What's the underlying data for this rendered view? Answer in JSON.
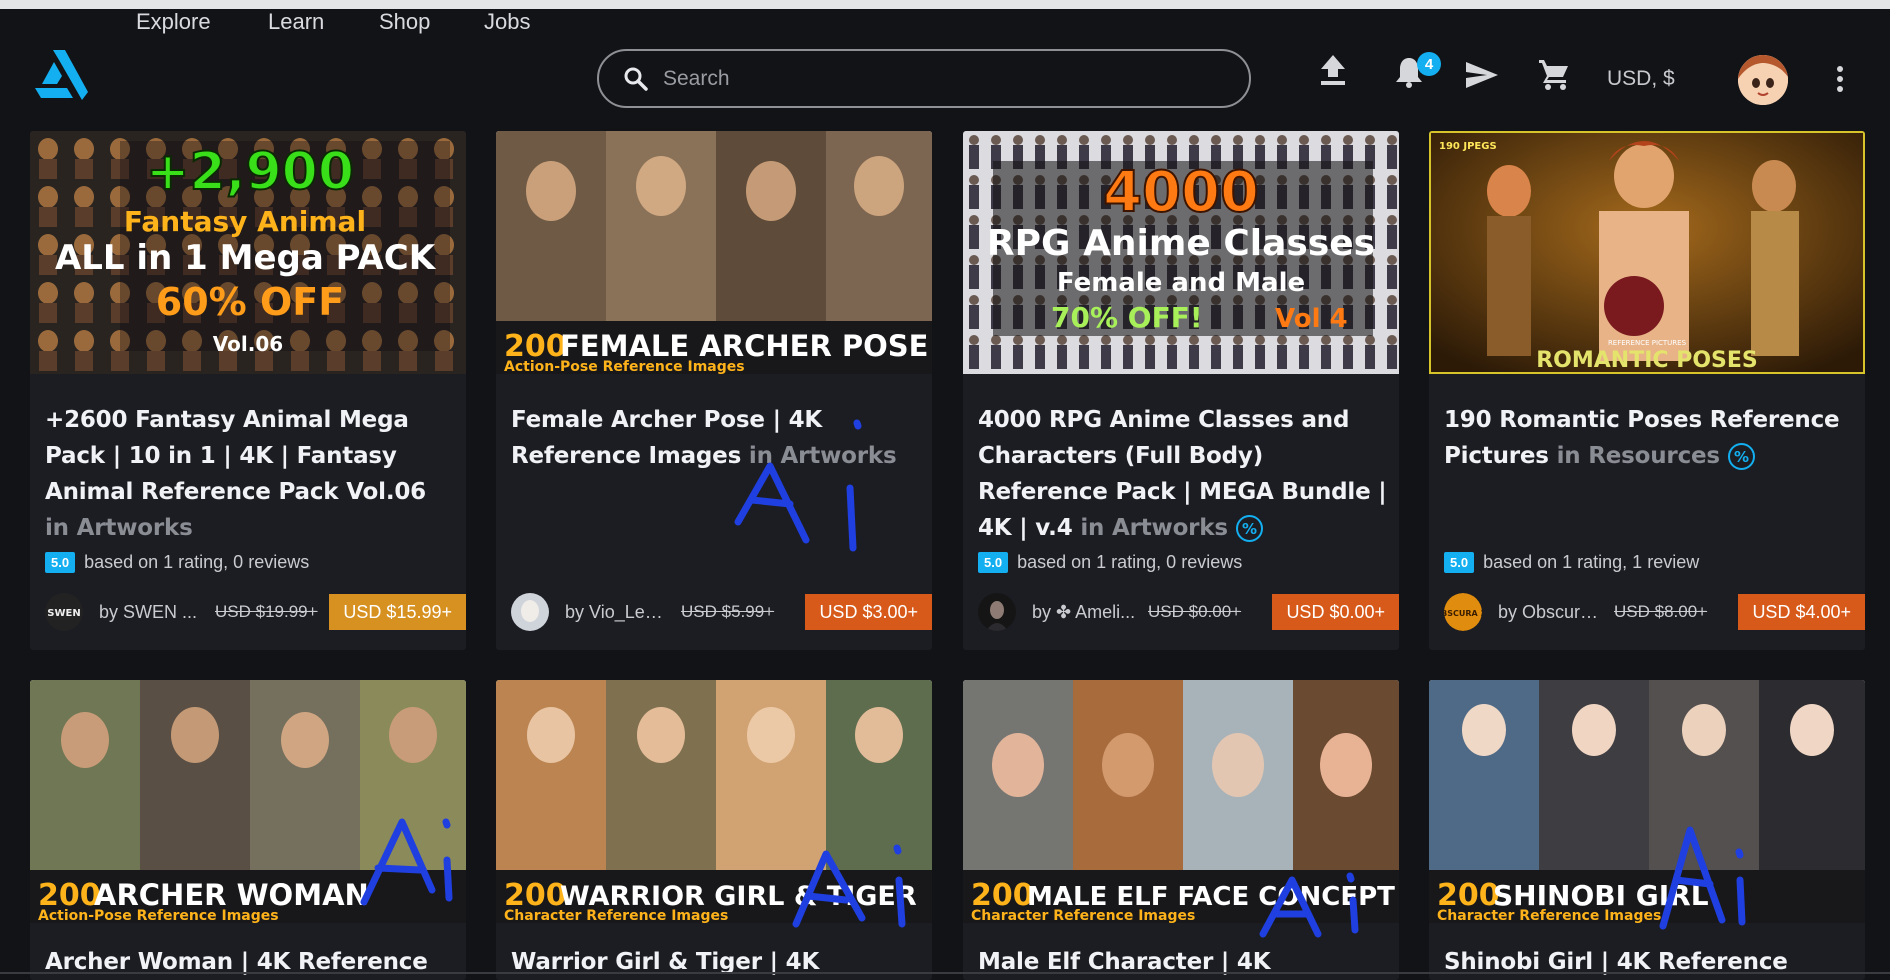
{
  "nav": {
    "items": [
      "Explore",
      "Learn",
      "Shop",
      "Jobs"
    ]
  },
  "search": {
    "placeholder": "Search"
  },
  "header": {
    "notification_count": "4",
    "currency": "USD, $"
  },
  "icons": {
    "logo": "artstation-logo",
    "search": "search-icon",
    "upload": "upload-icon",
    "notifications": "bell-icon",
    "messages": "send-icon",
    "cart": "cart-icon",
    "more": "kebab-icon"
  },
  "colors": {
    "accent": "#13aff0",
    "price_gold": "#d69120",
    "price_orange": "#d75a1a",
    "background": "#121317",
    "card": "#1c1d23"
  },
  "cards": [
    {
      "thumb_lines": [
        "+2,900",
        "Fantasy Animal",
        "ALL in 1 Mega PACK",
        "60% OFF",
        "Vol.06"
      ],
      "title": "+2600 Fantasy Animal Mega Pack | 10 in 1 | 4K | Fantasy Animal Reference Pack Vol.06",
      "where": "in Artworks",
      "rating": "5.0",
      "rating_text": "based on 1 rating, 0 reviews",
      "seller_avatar_text": "SWEN",
      "seller": "by SWEN ...",
      "old_price": "USD $19.99+",
      "price": "USD $15.99+"
    },
    {
      "thumb_lines": [
        "200",
        "FEMALE ARCHER POSE",
        "Action-Pose Reference Images"
      ],
      "title": "Female Archer Pose | 4K Reference Images",
      "where": "in Artworks",
      "rating": "",
      "rating_text": "",
      "seller": "by Vio_Lem...",
      "old_price": "USD $5.99+",
      "price": "USD $3.00+"
    },
    {
      "thumb_lines": [
        "4000",
        "RPG Anime Classes",
        "Female and Male",
        "70% OFF!",
        "Vol 4"
      ],
      "title": "4000 RPG Anime Classes and Characters (Full Body) Reference Pack | MEGA Bundle | 4K | v.4",
      "where": "in Artworks",
      "rating": "5.0",
      "rating_text": "based on 1 rating, 0 reviews",
      "seller": "by ✤ Ameli...",
      "old_price": "USD $0.00+",
      "price": "USD $0.00+"
    },
    {
      "thumb_lines": [
        "190 JPEGS",
        "REFERENCE PICTURES",
        "ROMANTIC POSES"
      ],
      "title": "190 Romantic Poses Reference Pictures",
      "where": "in Resources",
      "rating": "5.0",
      "rating_text": "based on 1 rating, 1 review",
      "seller_avatar_text": "OBSCURA 28",
      "seller": "by Obscura ...",
      "old_price": "USD $8.00+",
      "price": "USD $4.00+"
    },
    {
      "thumb_lines": [
        "200",
        "ARCHER WOMAN",
        "Action-Pose Reference Images"
      ],
      "title": "Archer Woman | 4K Reference"
    },
    {
      "thumb_lines": [
        "200",
        "WARRIOR GIRL & TIGER",
        "Character Reference Images"
      ],
      "title": "Warrior Girl & Tiger | 4K"
    },
    {
      "thumb_lines": [
        "200",
        "MALE ELF FACE CONCEPT",
        "Character Reference Images"
      ],
      "title": "Male Elf Character | 4K"
    },
    {
      "thumb_lines": [
        "200",
        "SHINOBI GIRL",
        "Character Reference Images"
      ],
      "title": "Shinobi Girl | 4K Reference"
    }
  ]
}
